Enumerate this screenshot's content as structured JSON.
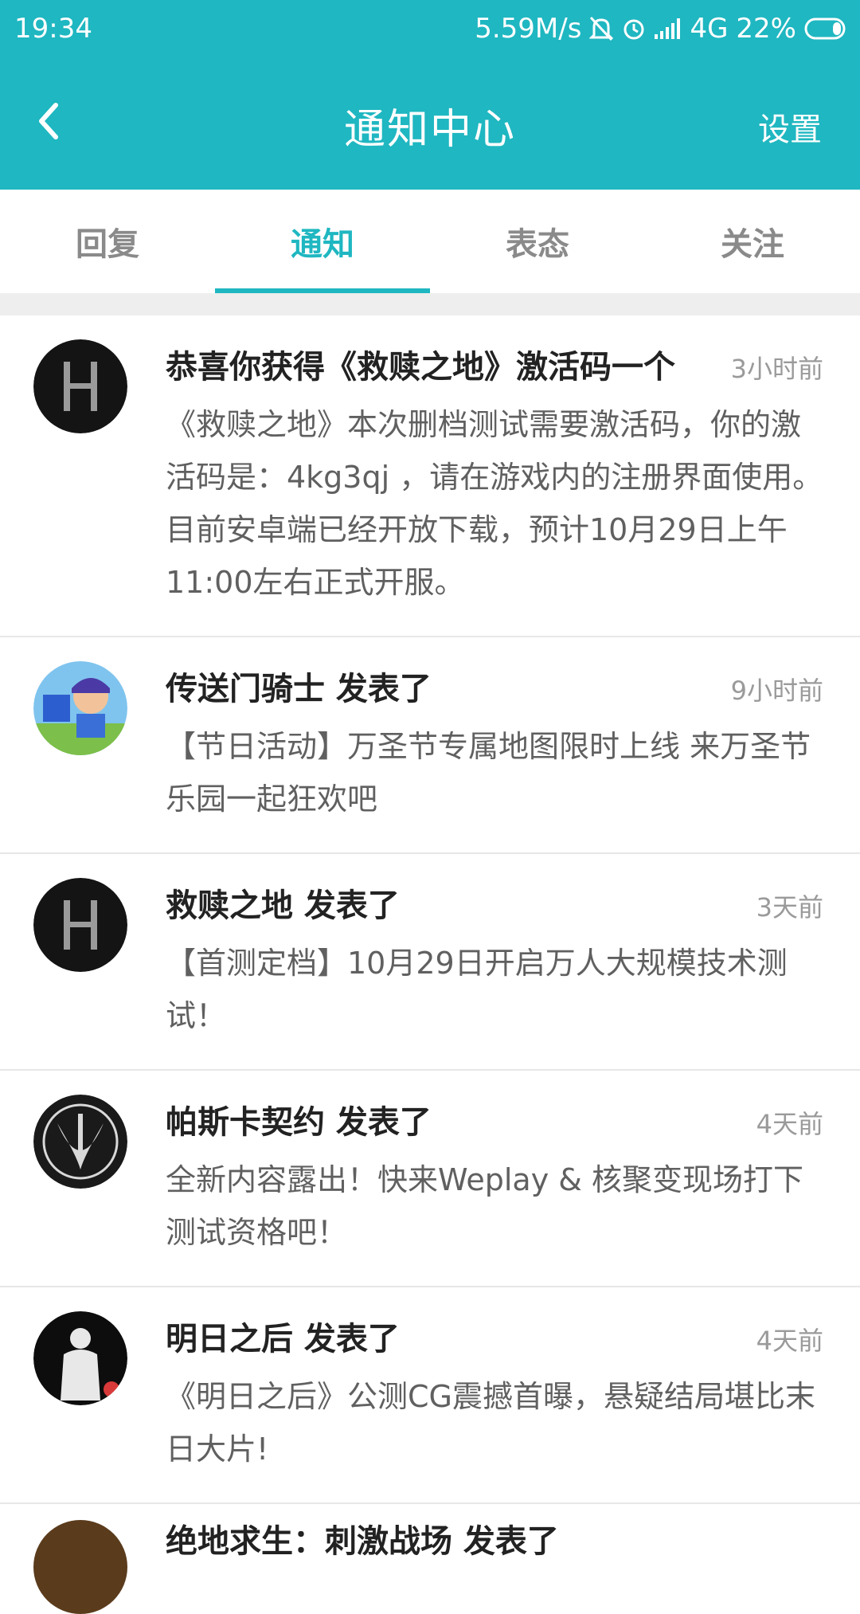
{
  "status_bar": {
    "time": "19:34",
    "speed": "5.59M/s",
    "network": "4G",
    "battery": "22%"
  },
  "app_bar": {
    "title": "通知中心",
    "settings": "设置"
  },
  "tabs": [
    {
      "label": "回复"
    },
    {
      "label": "通知"
    },
    {
      "label": "表态"
    },
    {
      "label": "关注"
    }
  ],
  "active_tab": "通知",
  "notifications": [
    {
      "title": "恭喜你获得《救赎之地》激活码一个",
      "time": "3小时前",
      "body": "《救赎之地》本次删档测试需要激活码，你的激活码是：4kg3qj ，请在游戏内的注册界面使用。目前安卓端已经开放下载，预计10月29日上午11:00左右正式开服。"
    },
    {
      "title": "传送门骑士 发表了",
      "time": "9小时前",
      "body": "【节日活动】万圣节专属地图限时上线 来万圣节乐园一起狂欢吧"
    },
    {
      "title": "救赎之地 发表了",
      "time": "3天前",
      "body": "【首测定档】10月29日开启万人大规模技术测试！"
    },
    {
      "title": "帕斯卡契约 发表了",
      "time": "4天前",
      "body": "全新内容露出！快来Weplay & 核聚变现场打下测试资格吧！"
    },
    {
      "title": "明日之后 发表了",
      "time": "4天前",
      "body": "《明日之后》公测CG震撼首曝，悬疑结局堪比末日大片!"
    }
  ],
  "partial_item_title": "绝地求生：刺激战场 发表了"
}
